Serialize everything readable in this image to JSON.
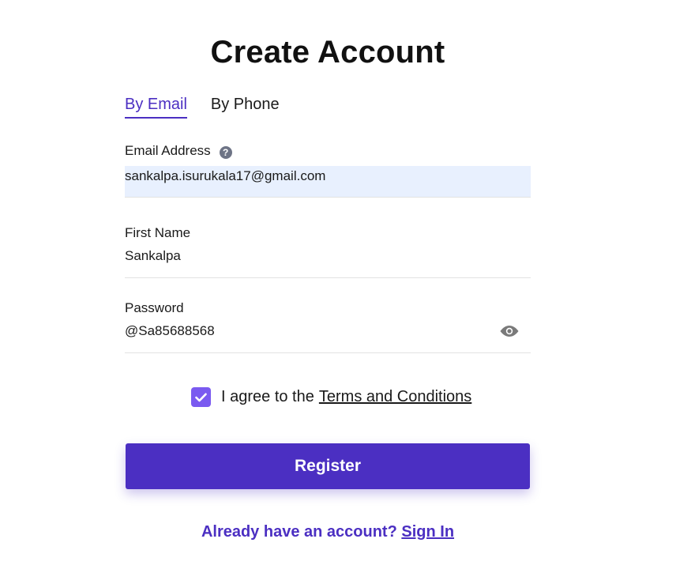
{
  "title": "Create Account",
  "tabs": [
    {
      "label": "By Email",
      "active": true
    },
    {
      "label": "By Phone",
      "active": false
    }
  ],
  "email": {
    "label": "Email Address",
    "value": "sankalpa.isurukala17@gmail.com",
    "help_icon": "question-circle"
  },
  "first_name": {
    "label": "First Name",
    "value": "Sankalpa"
  },
  "password": {
    "label": "Password",
    "value": "@Sa85688568",
    "toggle_icon": "eye"
  },
  "agreement": {
    "checked": true,
    "text": "I agree to the",
    "link_label": "Terms and Conditions"
  },
  "register_label": "Register",
  "signin": {
    "prompt": "Already have an account?",
    "link_label": "Sign In"
  },
  "colors": {
    "accent": "#4b2fc2",
    "checkbox": "#7a5af0",
    "autofill_background": "#e8f0fe"
  }
}
